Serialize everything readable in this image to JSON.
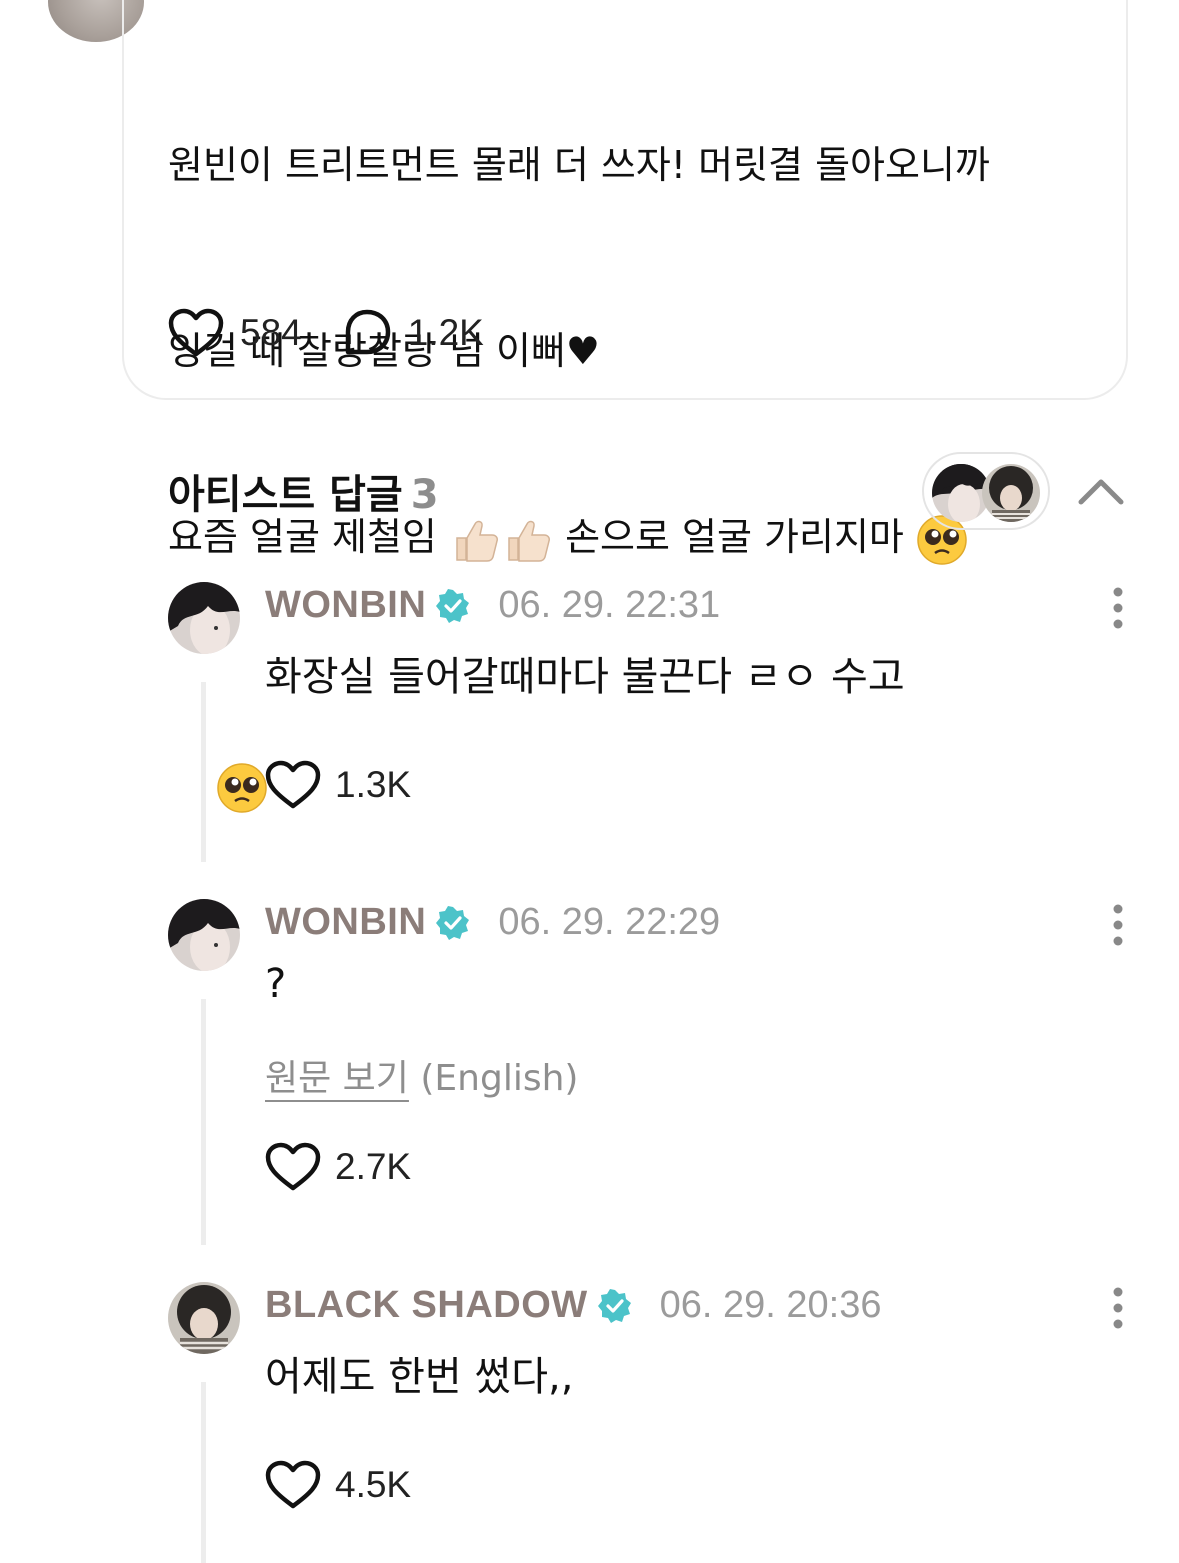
{
  "post": {
    "lines": [
      "원빈이 트리트먼트 몰래 더 쓰자! 머릿결 돌아오니까",
      "잉걸 때 찰랑찰랑 넘 이뻐",
      "요즘 얼굴 제철임",
      "손으로 얼굴 가리지마"
    ],
    "heart_glyph": "♥",
    "like_count": "584",
    "comment_count": "1.2K"
  },
  "replies_section": {
    "title": "아티스트 답글",
    "count": "3"
  },
  "replies": [
    {
      "author": "WONBIN",
      "time": "06. 29. 22:31",
      "text": "화장실 들어갈때마다 불끈다 ㄹㅇ 수고",
      "likes": "1.3K"
    },
    {
      "author": "WONBIN",
      "time": "06. 29. 22:29",
      "text": "?",
      "translate_link": "원문 보기",
      "translate_lang": "(English)",
      "likes": "2.7K"
    },
    {
      "author": "BLACK SHADOW",
      "time": "06. 29. 20:36",
      "text": "어제도 한번 썼다,,",
      "likes": "4.5K"
    }
  ],
  "colors": {
    "author": "#8b7d79",
    "verified": "#4cc3c9",
    "muted": "#9b9b9b"
  },
  "icons": {
    "like": "heart-outline-icon",
    "comment": "speech-bubble-icon",
    "more": "vertical-dots-icon",
    "collapse": "chevron-up-icon",
    "verified": "verified-badge-icon"
  }
}
